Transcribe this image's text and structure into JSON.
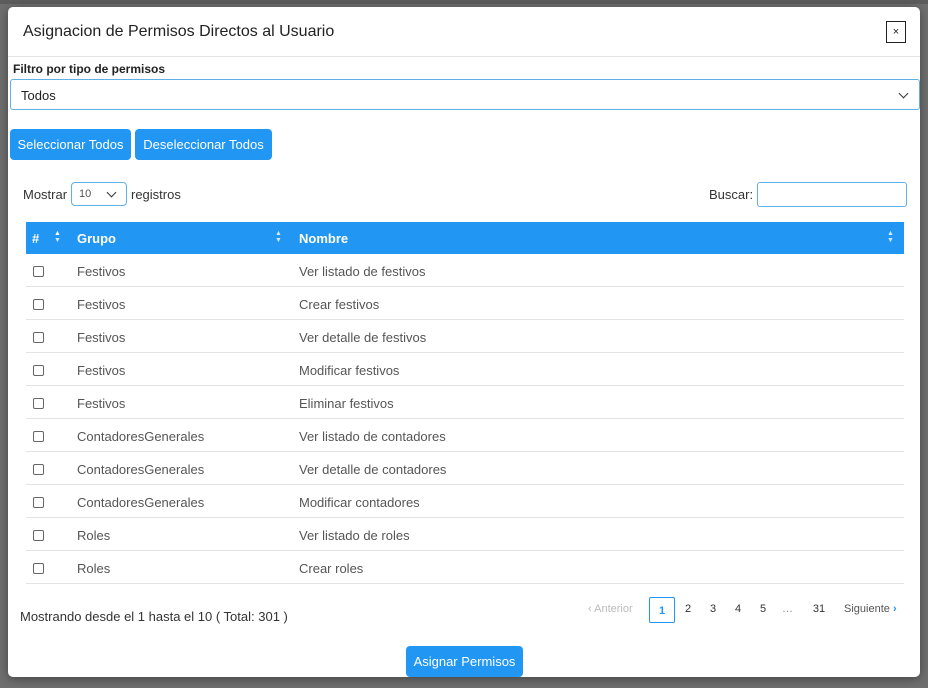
{
  "modal": {
    "title": "Asignacion de Permisos Directos al Usuario",
    "close_label": "×"
  },
  "filter": {
    "label": "Filtro por tipo de permisos",
    "selected": "Todos"
  },
  "actions": {
    "select_all": "Seleccionar Todos",
    "deselect_all": "Deseleccionar Todos",
    "assign": "Asignar Permisos"
  },
  "length_menu": {
    "show_label": "Mostrar",
    "selected": "10",
    "records_label": "registros"
  },
  "search": {
    "label": "Buscar:",
    "value": ""
  },
  "table": {
    "columns": [
      "#",
      "Grupo",
      "Nombre"
    ],
    "rows": [
      {
        "group": "Festivos",
        "name": "Ver listado de festivos",
        "checked": false
      },
      {
        "group": "Festivos",
        "name": "Crear festivos",
        "checked": false
      },
      {
        "group": "Festivos",
        "name": "Ver detalle de festivos",
        "checked": false
      },
      {
        "group": "Festivos",
        "name": "Modificar festivos",
        "checked": false
      },
      {
        "group": "Festivos",
        "name": "Eliminar festivos",
        "checked": false
      },
      {
        "group": "ContadoresGenerales",
        "name": "Ver listado de contadores",
        "checked": false
      },
      {
        "group": "ContadoresGenerales",
        "name": "Ver detalle de contadores",
        "checked": false
      },
      {
        "group": "ContadoresGenerales",
        "name": "Modificar contadores",
        "checked": false
      },
      {
        "group": "Roles",
        "name": "Ver listado de roles",
        "checked": false
      },
      {
        "group": "Roles",
        "name": "Crear roles",
        "checked": false
      }
    ]
  },
  "info": "Mostrando desde el 1 hasta el 10 ( Total: 301 )",
  "pagination": {
    "previous": "Anterior",
    "next": "Siguiente",
    "pages": [
      "1",
      "2",
      "3",
      "4",
      "5"
    ],
    "ellipsis": "…",
    "last": "31",
    "current": "1"
  },
  "colors": {
    "primary": "#2196f3",
    "backdrop": "#6f6f6f"
  }
}
